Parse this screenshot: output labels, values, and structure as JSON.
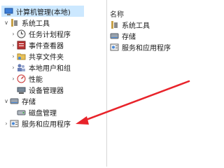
{
  "tree": {
    "root_label": "计算机管理(本地)",
    "system_tools_label": "系统工具",
    "task_scheduler_label": "任务计划程序",
    "event_viewer_label": "事件查看器",
    "shared_folders_label": "共享文件夹",
    "local_users_label": "本地用户和组",
    "performance_label": "性能",
    "device_manager_label": "设备管理器",
    "storage_label": "存储",
    "disk_management_label": "磁盘管理",
    "services_apps_label": "服务和应用程序"
  },
  "list": {
    "column_header": "名称",
    "items": [
      "系统工具",
      "存储",
      "服务和应用程序"
    ]
  },
  "colors": {
    "selection": "#cce8ff",
    "arrow": "#e8232a"
  },
  "icons": {
    "collapse": "chevron-down-icon",
    "expand": "chevron-right-icon"
  }
}
